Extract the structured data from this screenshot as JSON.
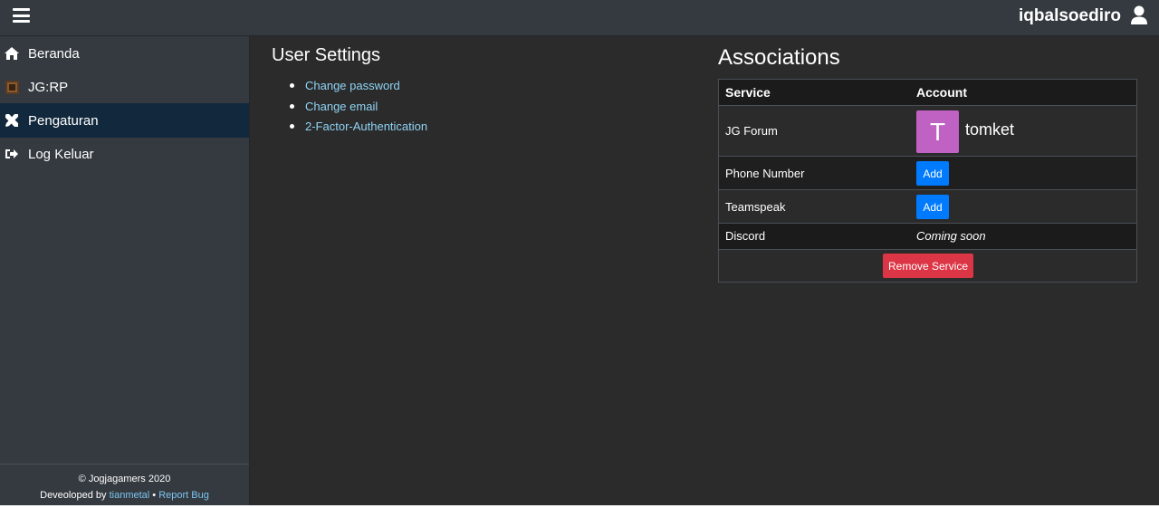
{
  "header": {
    "menu_icon": "hamburger-icon",
    "username": "iqbalsoediro",
    "user_icon": "user-icon"
  },
  "sidebar": {
    "items": [
      {
        "label": "Beranda",
        "icon": "home-icon",
        "active": false
      },
      {
        "label": "JG:RP",
        "icon": "jgrp-logo-icon",
        "active": false
      },
      {
        "label": "Pengaturan",
        "icon": "tools-icon",
        "active": true
      },
      {
        "label": "Log Keluar",
        "icon": "sign-out-icon",
        "active": false
      }
    ],
    "footer": {
      "copyright": "© Jogjagamers 2020",
      "developed_prefix": "Deveoloped by",
      "developer": "tianmetal",
      "separator": "•",
      "report_bug": "Report Bug"
    }
  },
  "user_settings": {
    "title": "User Settings",
    "links": [
      "Change password",
      "Change email",
      "2-Factor-Authentication"
    ]
  },
  "associations": {
    "title": "Associations",
    "headers": {
      "service": "Service",
      "account": "Account"
    },
    "rows": [
      {
        "service": "JG Forum",
        "avatar_letter": "T",
        "account": "tomket"
      },
      {
        "service": "Phone Number",
        "action": "Add"
      },
      {
        "service": "Teamspeak",
        "action": "Add"
      },
      {
        "service": "Discord",
        "account": "Coming soon"
      }
    ],
    "remove_label": "Remove Service"
  },
  "colors": {
    "topbar": "#343a40",
    "background": "#2b2b2b",
    "active_nav": "#12283d",
    "link": "#8fd3f5",
    "add_button": "#007bff",
    "remove_button": "#dc3545",
    "avatar": "#c061c4"
  }
}
